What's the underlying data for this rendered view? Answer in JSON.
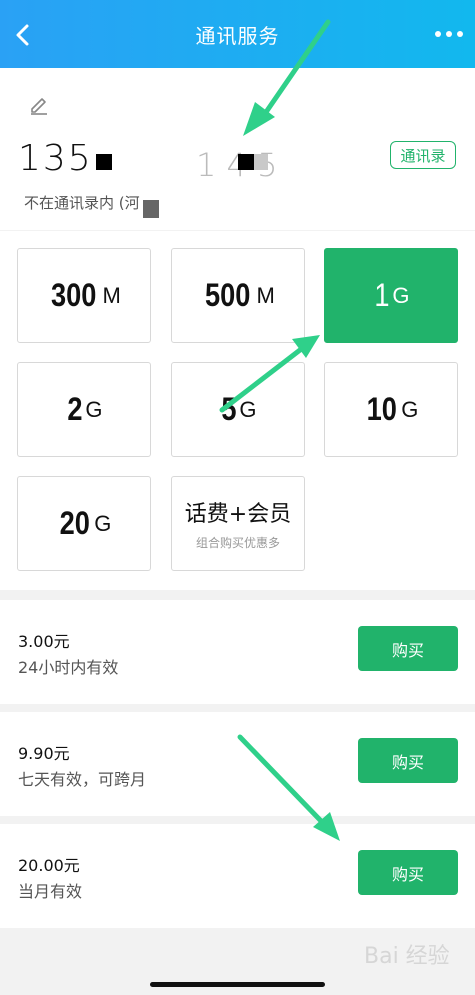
{
  "header": {
    "title": "通讯服务",
    "back_icon": "chevron-left-icon",
    "more_icon": "more-dots-icon"
  },
  "contact": {
    "edit_icon": "pencil-icon",
    "phone_prefix": "135",
    "phone_suffix": "1 4 5",
    "contacts_button": "通讯录",
    "status": "不在通讯录内 (河"
  },
  "data_plans": [
    {
      "amount": "300",
      "unit": "M",
      "selected": false
    },
    {
      "amount": "500",
      "unit": "M",
      "selected": false
    },
    {
      "amount": "1",
      "unit": "G",
      "selected": true
    },
    {
      "amount": "2",
      "unit": "G",
      "selected": false
    },
    {
      "amount": "5",
      "unit": "G",
      "selected": false
    },
    {
      "amount": "10",
      "unit": "G",
      "selected": false
    },
    {
      "amount": "20",
      "unit": "G",
      "selected": false
    }
  ],
  "combo": {
    "title": "话费+会员",
    "subtitle": "组合购买优惠多"
  },
  "offers": [
    {
      "price": "3.00元",
      "validity": "24小时内有效",
      "button": "购买"
    },
    {
      "price": "9.90元",
      "validity": "七天有效，可跨月",
      "button": "购买"
    },
    {
      "price": "20.00元",
      "validity": "当月有效",
      "button": "购买"
    }
  ],
  "watermark": "Bai 经验",
  "colors": {
    "header_start": "#2aa1f5",
    "header_end": "#12b8ee",
    "accent_green": "#21b36b",
    "arrow_green": "#2fd08a"
  }
}
